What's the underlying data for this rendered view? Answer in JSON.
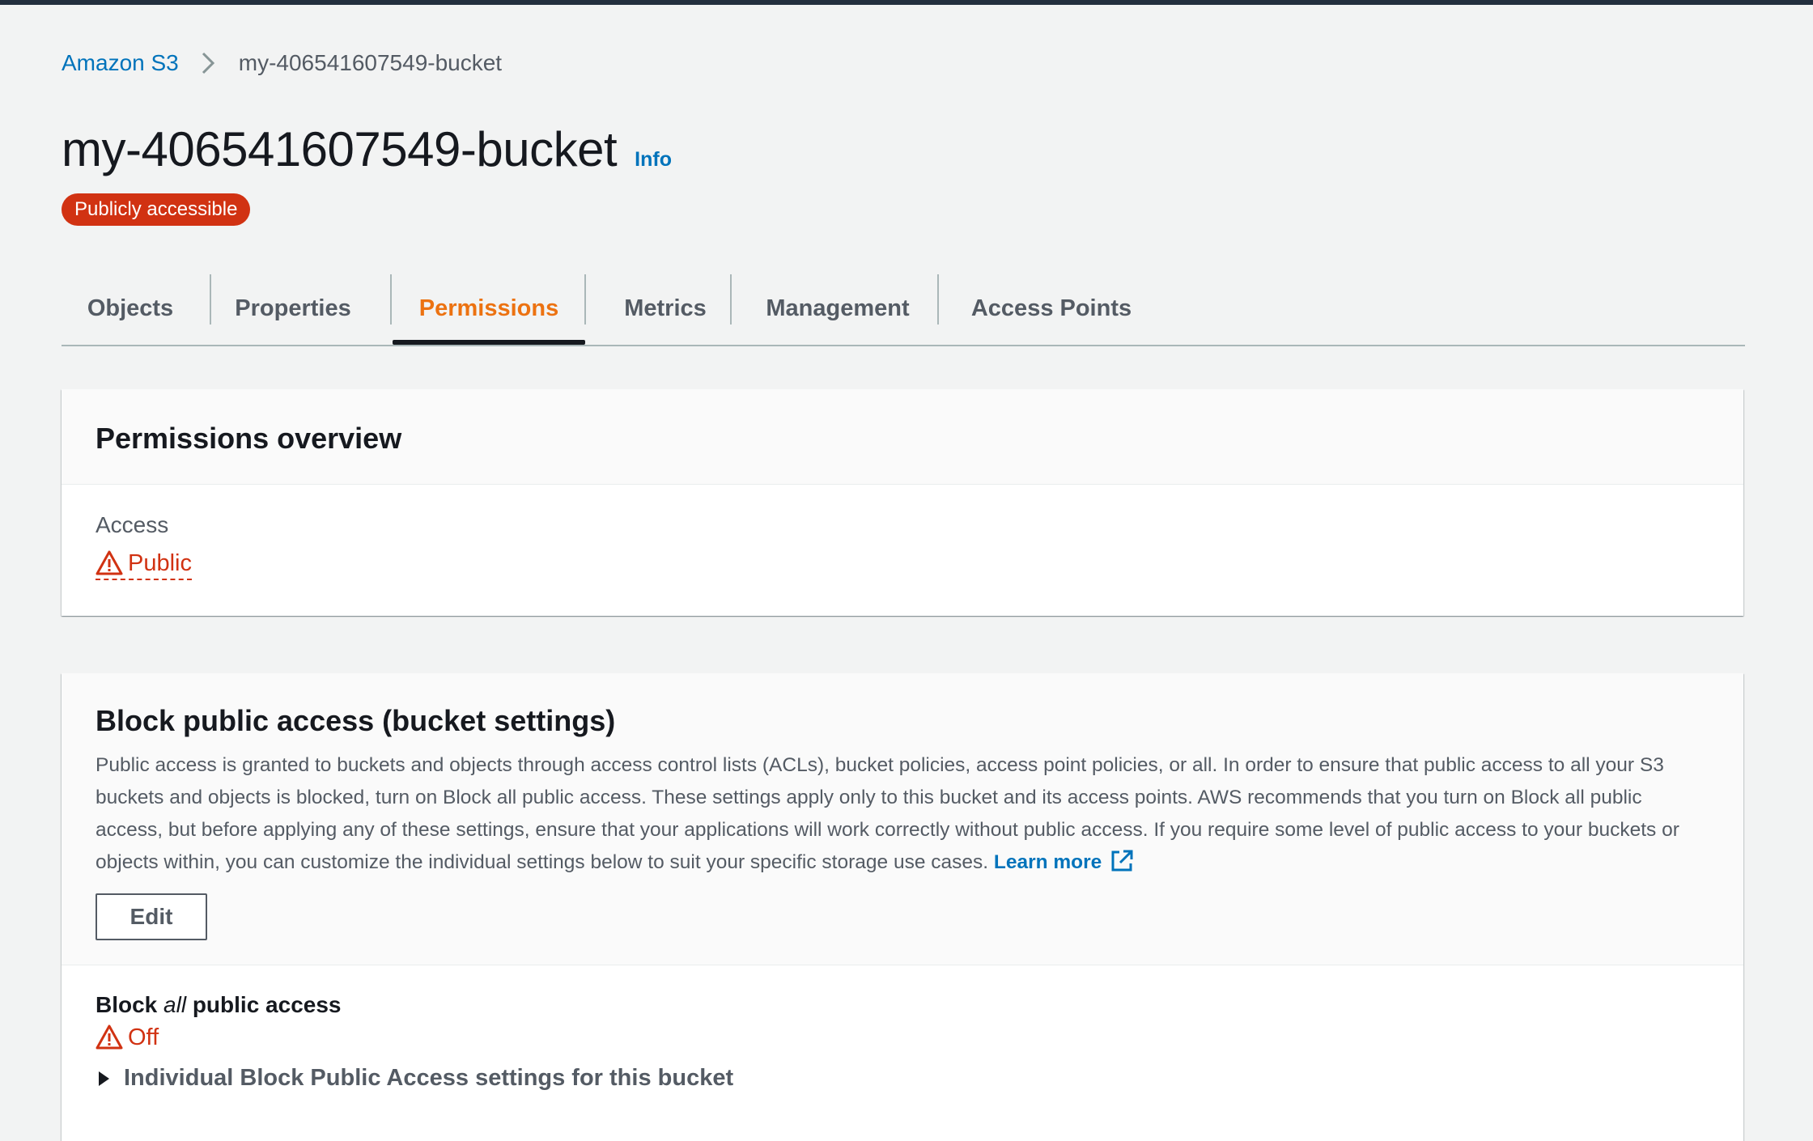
{
  "breadcrumb": {
    "root": "Amazon S3",
    "current": "my-406541607549-bucket"
  },
  "header": {
    "title": "my-406541607549-bucket",
    "info": "Info",
    "badge": "Publicly accessible"
  },
  "tabs": [
    {
      "label": "Objects"
    },
    {
      "label": "Properties"
    },
    {
      "label": "Permissions",
      "active": true
    },
    {
      "label": "Metrics"
    },
    {
      "label": "Management"
    },
    {
      "label": "Access Points"
    }
  ],
  "permissions_overview": {
    "title": "Permissions overview",
    "access_label": "Access",
    "access_value": "Public"
  },
  "block_public_access": {
    "title": "Block public access (bucket settings)",
    "description": "Public access is granted to buckets and objects through access control lists (ACLs), bucket policies, access point policies, or all. In order to ensure that public access to all your S3 buckets and objects is blocked, turn on Block all public access. These settings apply only to this bucket and its access points. AWS recommends that you turn on Block all public access, but before applying any of these settings, ensure that your applications will work correctly without public access. If you require some level of public access to your buckets or objects within, you can customize the individual settings below to suit your specific storage use cases.",
    "learn_more": "Learn more",
    "edit_label": "Edit",
    "block_all_prefix": "Block",
    "block_all_emphasis": "all",
    "block_all_suffix": "public access",
    "block_all_value": "Off",
    "individual_settings": "Individual Block Public Access settings for this bucket"
  },
  "colors": {
    "accent": "#ec7211",
    "link": "#0073bb",
    "danger": "#d13212",
    "topbar": "#232f3e"
  },
  "icons": [
    "chevron-right-icon",
    "warning-icon",
    "external-link-icon",
    "caret-right-icon"
  ]
}
